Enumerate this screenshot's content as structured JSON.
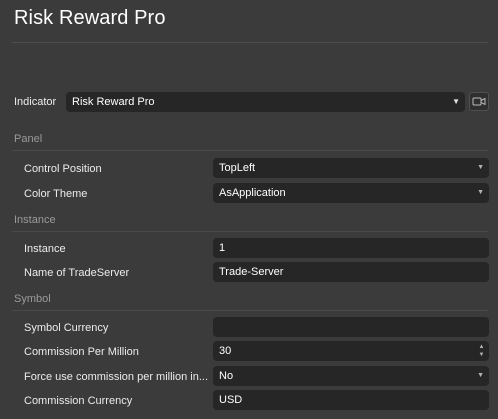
{
  "header": {
    "title": "Risk Reward Pro"
  },
  "indicator": {
    "label": "Indicator",
    "value": "Risk Reward Pro"
  },
  "sections": {
    "panel": "Panel",
    "instance": "Instance",
    "symbol": "Symbol"
  },
  "panel": {
    "control_position": {
      "label": "Control Position",
      "value": "TopLeft"
    },
    "color_theme": {
      "label": "Color Theme",
      "value": "AsApplication"
    }
  },
  "instance": {
    "instance": {
      "label": "Instance",
      "value": "1"
    },
    "trade_server": {
      "label": "Name of TradeServer",
      "value": "Trade-Server"
    }
  },
  "symbol": {
    "symbol_currency": {
      "label": "Symbol Currency",
      "value": ""
    },
    "commission_per_million": {
      "label": "Commission Per Million",
      "value": "30"
    },
    "force_commission": {
      "label": "Force use commission per million in...",
      "value": "No"
    },
    "commission_currency": {
      "label": "Commission Currency",
      "value": "USD"
    }
  },
  "icons": {
    "camera": "video-camera-icon",
    "dropdown": "caret-down-icon",
    "spinner": "spinner-arrows-icon"
  }
}
